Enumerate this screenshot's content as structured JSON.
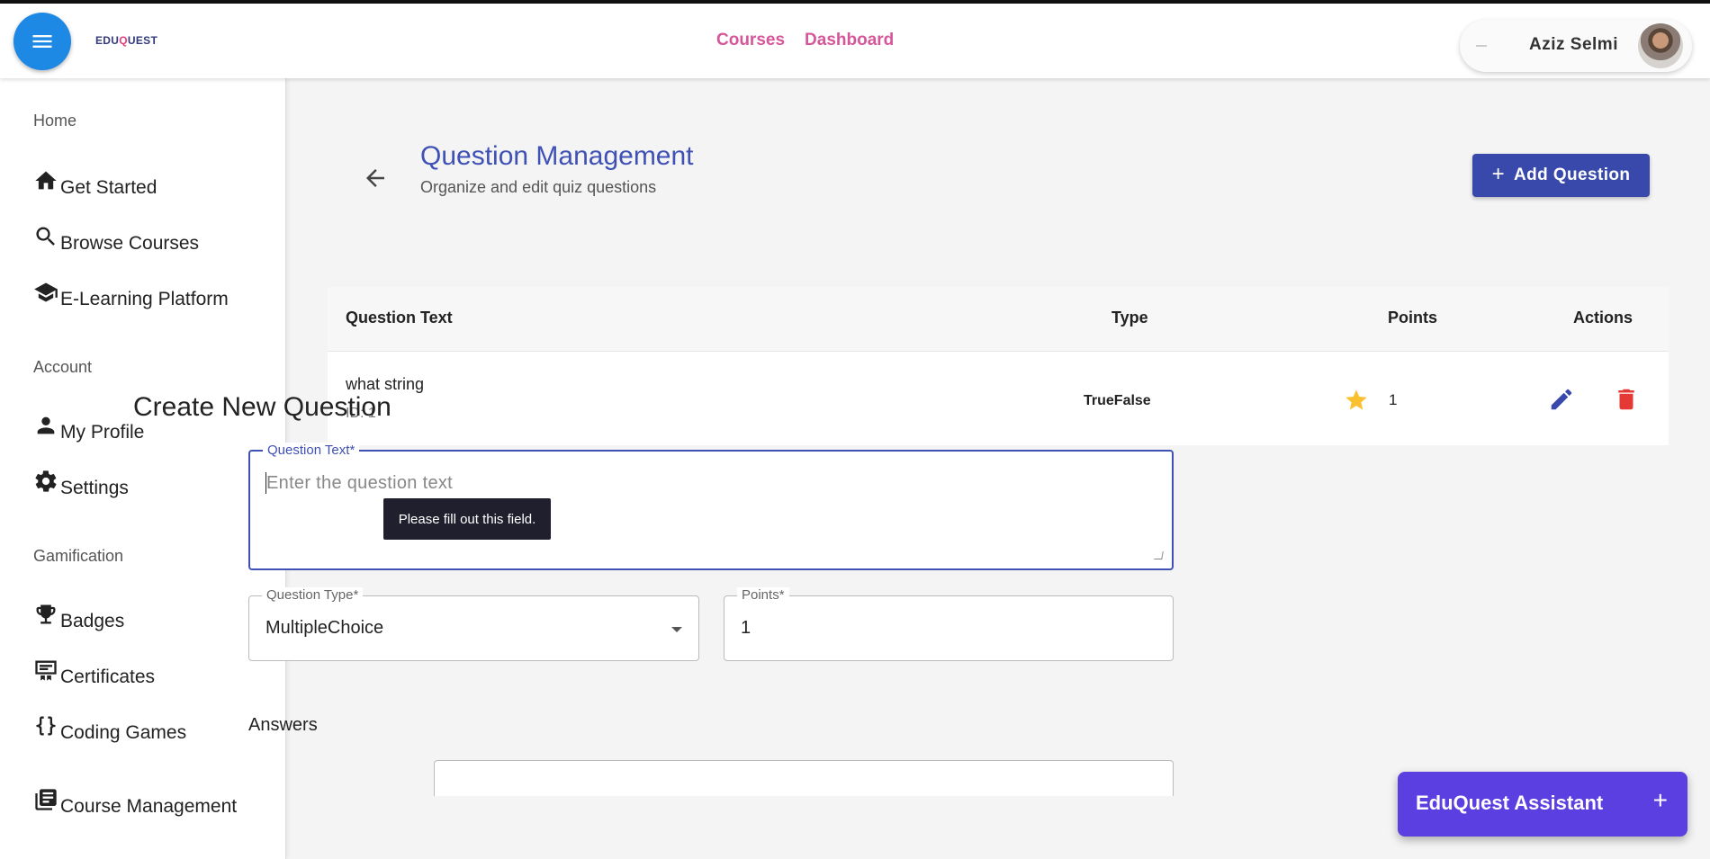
{
  "app": {
    "logo_prefix": "EDU",
    "logo_q": "Q",
    "logo_suffix": "UEST"
  },
  "nav": {
    "courses": "Courses",
    "dashboard": "Dashboard"
  },
  "user": {
    "name": "Aziz Selmi"
  },
  "sidebar": {
    "sections": {
      "home": "Home",
      "account": "Account",
      "gamification": "Gamification"
    },
    "items": [
      {
        "label": "Get Started",
        "icon": "home-icon"
      },
      {
        "label": "Browse Courses",
        "icon": "search-icon"
      },
      {
        "label": "E-Learning Platform",
        "icon": "school-icon"
      },
      {
        "label": "My Profile",
        "icon": "person-icon"
      },
      {
        "label": "Settings",
        "icon": "gear-icon"
      },
      {
        "label": "Badges",
        "icon": "trophy-icon"
      },
      {
        "label": "Certificates",
        "icon": "certificate-icon"
      },
      {
        "label": "Coding Games",
        "icon": "code-braces-icon"
      },
      {
        "label": "Course Management",
        "icon": "library-books-icon"
      }
    ]
  },
  "page": {
    "title": "Question Management",
    "subtitle": "Organize and edit quiz questions",
    "add_button": "Add Question"
  },
  "table": {
    "headers": {
      "text": "Question Text",
      "type": "Type",
      "points": "Points",
      "actions": "Actions"
    },
    "rows": [
      {
        "text": "what string",
        "id": "ID: 1",
        "type": "TrueFalse",
        "points": "1"
      }
    ]
  },
  "form": {
    "title": "Create New Question",
    "question_text_label": "Question Text*",
    "question_text_placeholder": "Enter the question text",
    "tooltip": "Please fill out this field.",
    "question_type_label": "Question Type*",
    "question_type_value": "MultipleChoice",
    "points_label": "Points*",
    "points_value": "1",
    "answers_label": "Answers"
  },
  "assistant": {
    "label": "EduQuest Assistant",
    "plus": "+"
  },
  "colors": {
    "primary": "#3f51b5",
    "menu_button": "#1e88e5",
    "nav_link": "#d6569a",
    "assistant": "#5c3fe0",
    "delete": "#e53935",
    "star": "#fbc02d"
  }
}
